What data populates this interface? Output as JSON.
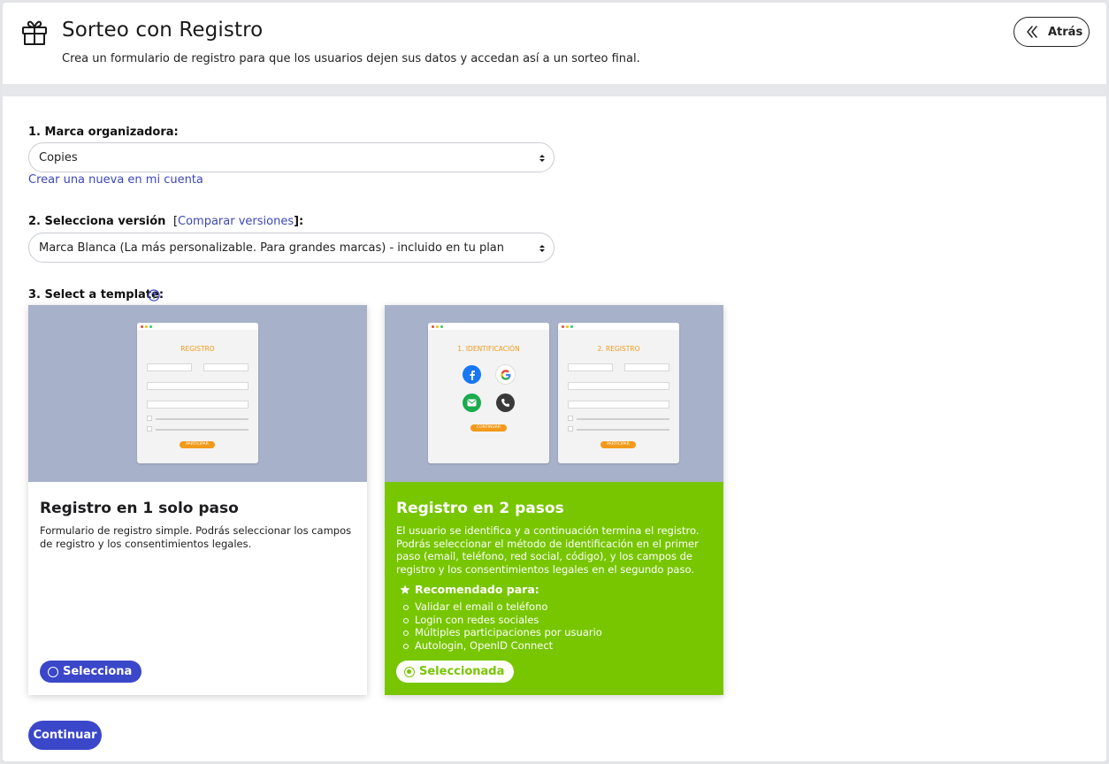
{
  "header": {
    "title": "Sorteo con Registro",
    "subtitle": "Crea un formulario de registro para que los usuarios dejen sus datos y accedan así a un sorteo final.",
    "back_label": "Atrás"
  },
  "step1": {
    "label": "1. Marca organizadora:",
    "selected": "Copies",
    "create_link": "Crear una nueva en mi cuenta"
  },
  "step2": {
    "label": "2. Selecciona versión",
    "bracket_open": "[",
    "compare_link": "Comparar versiones",
    "bracket_close": "]:",
    "selected": "Marca Blanca (La más personalizable. Para grandes marcas) - incluido en tu plan"
  },
  "step3": {
    "label": "3. Select a template:"
  },
  "templates": [
    {
      "title": "Registro en 1 solo paso",
      "description": "Formulario de registro simple. Podrás seleccionar los campos de registro y los consentimientos legales.",
      "button_label": "Selecciona",
      "selected": false,
      "preview": {
        "title": "REGISTRO",
        "button": "PARTICIPAR"
      }
    },
    {
      "title": "Registro en 2 pasos",
      "description": "El usuario se identifica y a continuación termina el registro. Podrás seleccionar el método de identificación en el primer paso (email, teléfono, red social, código), y los campos de registro y los consentimientos legales en el segundo paso.",
      "recommended_title": "Recomendado para:",
      "recommended": [
        "Validar el email o teléfono",
        "Login con redes sociales",
        "Múltiples participaciones por usuario",
        "Autologin, OpenID Connect"
      ],
      "button_label": "Seleccionada",
      "selected": true,
      "preview": {
        "step1_title": "1. IDENTIFICACIÓN",
        "step1_button": "CONTINUAR",
        "step2_title": "2. REGISTRO",
        "step2_button": "PARTICIPAR"
      }
    }
  ],
  "continue_label": "Continuar",
  "colors": {
    "primary": "#3b47c9",
    "selected_green": "#77c600",
    "preview_bg": "#a7b1c9",
    "accent_orange": "#f29a1a",
    "link": "#3b47b5"
  },
  "icons": [
    "gift-icon",
    "double-chevron-left-icon",
    "select-arrows-icon",
    "help-icon",
    "star-icon",
    "facebook-icon",
    "google-icon",
    "sms-icon",
    "phone-icon"
  ]
}
